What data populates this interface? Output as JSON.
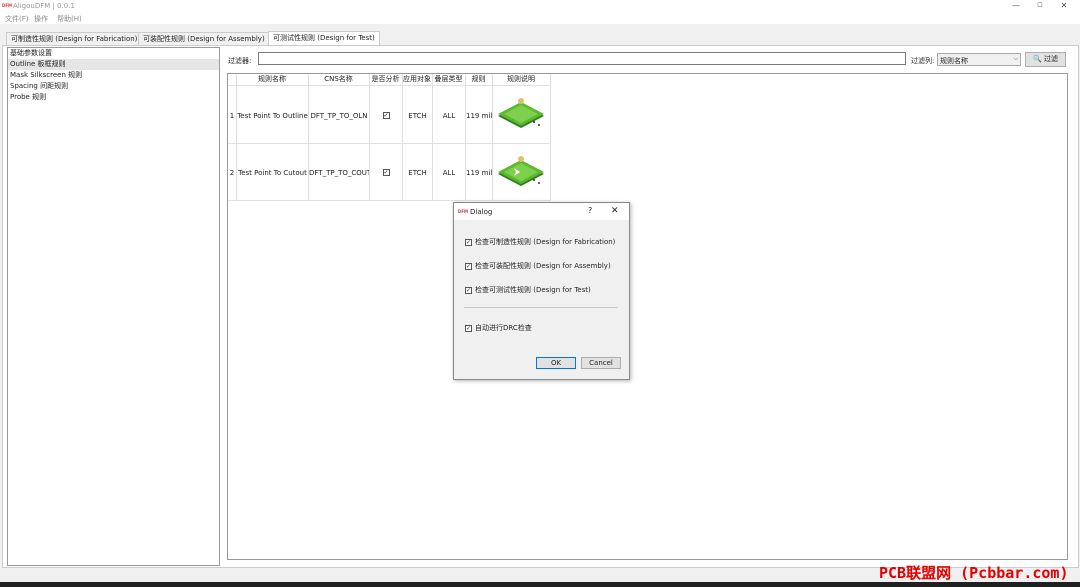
{
  "window": {
    "logo_text": "DFM",
    "title": "AligouDFM | 0.0.1",
    "minimize": "—",
    "maximize": "☐",
    "close": "✕"
  },
  "menu": [
    "文件(F)",
    "操作",
    "帮助(H)"
  ],
  "tabs": [
    {
      "label": "可制造性规则 (Design for Fabrication)",
      "active": false
    },
    {
      "label": "可装配性规则 (Design for Assembly)",
      "active": false
    },
    {
      "label": "可测试性规则 (Design for Test)",
      "active": true
    }
  ],
  "sidebar": {
    "items": [
      "基础参数设置",
      "Outline 板框规则",
      "Mask Silkscreen 规则",
      "Spacing 间距规则",
      "Probe 规则"
    ],
    "selected": 1
  },
  "filter": {
    "label": "过滤器:",
    "value": "",
    "column_label": "过滤列:",
    "column_value": "规则名称",
    "button": "过滤"
  },
  "table": {
    "headers": [
      "规则名称",
      "CNS名称",
      "是否分析",
      "应用对象",
      "叠层类型",
      "规则",
      "规则说明"
    ],
    "rows": [
      {
        "num": "1",
        "name": "Test Point To Outline",
        "cns": "DFT_TP_TO_OLN",
        "checked": true,
        "target": "ETCH",
        "layer": "ALL",
        "rule": "119 mil",
        "thumb": "test-point-to-outline-illustration"
      },
      {
        "num": "2",
        "name": "Test Point To Cutout",
        "cns": "DFT_TP_TO_COUT",
        "checked": true,
        "target": "ETCH",
        "layer": "ALL",
        "rule": "119 mil",
        "thumb": "test-point-to-cutout-illustration"
      }
    ]
  },
  "dialog": {
    "logo_text": "DFM",
    "title": "Dialog",
    "help": "?",
    "close": "✕",
    "options": [
      {
        "label": "检查可制造性规则 (Design for Fabrication)",
        "checked": true
      },
      {
        "label": "检查可装配性规则 (Design for Assembly)",
        "checked": true
      },
      {
        "label": "检查可测试性规则 (Design for Test)",
        "checked": true
      }
    ],
    "auto_drc": {
      "label": "自动进行DRC检查",
      "checked": true
    },
    "ok": "OK",
    "cancel": "Cancel"
  },
  "watermark": "PCB联盟网 (Pcbbar.com)",
  "colors": {
    "board_green": "#5cb82e",
    "board_dark": "#2e7d1e",
    "watermark": "#e60000"
  }
}
